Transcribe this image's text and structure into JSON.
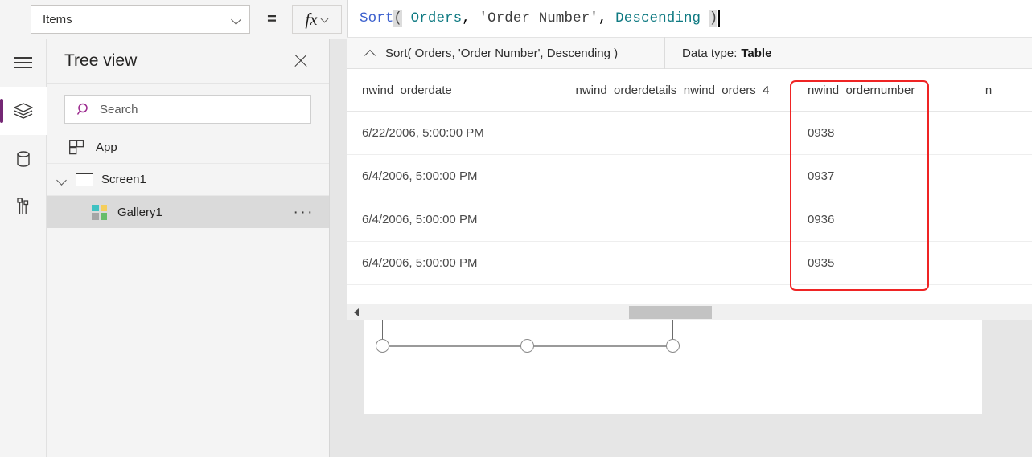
{
  "property_bar": {
    "selected_property": "Items",
    "equals_sign": "=",
    "fx_glyph": "fx"
  },
  "formula": {
    "tokens": [
      {
        "text": "Sort",
        "kind": "function"
      },
      {
        "text": "(",
        "kind": "paren"
      },
      {
        "text": " ",
        "kind": "plain"
      },
      {
        "text": "Orders",
        "kind": "identifier"
      },
      {
        "text": ", ",
        "kind": "plain"
      },
      {
        "text": "'Order Number'",
        "kind": "string"
      },
      {
        "text": ", ",
        "kind": "plain"
      },
      {
        "text": "Descending",
        "kind": "identifier"
      },
      {
        "text": " ",
        "kind": "plain"
      },
      {
        "text": ")",
        "kind": "paren"
      }
    ],
    "colors": {
      "function": "#3a5fcd",
      "identifier": "#0f7a82",
      "string": "#3b3b3b",
      "paren_highlight": "#dcdcdc"
    }
  },
  "info_row": {
    "preview_text": "Sort( Orders, 'Order Number', Descending )",
    "datatype_label": "Data type:",
    "datatype_value": "Table"
  },
  "rail": {
    "items": [
      {
        "icon": "hamburger-icon",
        "active": false
      },
      {
        "icon": "layers-icon",
        "active": true
      },
      {
        "icon": "database-icon",
        "active": false
      },
      {
        "icon": "insert-tools-icon",
        "active": false
      }
    ],
    "active_accent": "#742774"
  },
  "tree_view": {
    "title": "Tree view",
    "close_label": "×",
    "search": {
      "placeholder": "Search",
      "value": "",
      "icon_color": "#9c2a8f"
    },
    "nodes": [
      {
        "label": "App",
        "icon": "app-icon",
        "level": 0,
        "selected": false
      },
      {
        "label": "Screen1",
        "icon": "screen-icon",
        "level": 0,
        "selected": false,
        "expanded": true
      },
      {
        "label": "Gallery1",
        "icon": "gallery-icon",
        "level": 1,
        "selected": true,
        "overflow": "···"
      }
    ],
    "gallery_icon_colors": [
      "#3fc2c2",
      "#f5ce5b",
      "#a6a6a6",
      "#67bd6a"
    ]
  },
  "data_table": {
    "columns": [
      "nwind_orderdate",
      "nwind_orderdetails_nwind_orders_4",
      "nwind_ordernumber",
      "n"
    ],
    "rows": [
      {
        "nwind_orderdate": "6/22/2006, 5:00:00 PM",
        "nwind_orderdetails_nwind_orders_4": "",
        "nwind_ordernumber": "0938",
        "n": ""
      },
      {
        "nwind_orderdate": "6/4/2006, 5:00:00 PM",
        "nwind_orderdetails_nwind_orders_4": "",
        "nwind_ordernumber": "0937",
        "n": ""
      },
      {
        "nwind_orderdate": "6/4/2006, 5:00:00 PM",
        "nwind_orderdetails_nwind_orders_4": "",
        "nwind_ordernumber": "0936",
        "n": ""
      },
      {
        "nwind_orderdate": "6/4/2006, 5:00:00 PM",
        "nwind_orderdetails_nwind_orders_4": "",
        "nwind_ordernumber": "0935",
        "n": ""
      }
    ],
    "highlight": {
      "column": "nwind_ordernumber",
      "color": "#ef2424"
    }
  },
  "scrollbar": {
    "orientation": "horizontal",
    "thumb_color": "#c3c3c3"
  },
  "canvas": {
    "selected_control": "Gallery1",
    "handle_count": 3
  }
}
